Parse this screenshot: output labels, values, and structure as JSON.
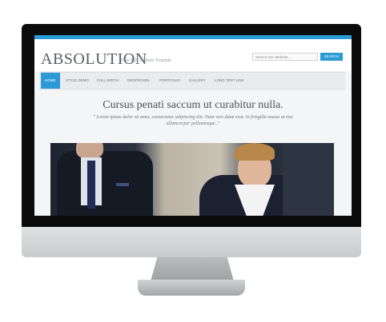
{
  "site": {
    "logo": "ABSOLUTION",
    "tagline": "Free PSD Website Template",
    "search_placeholder": "Search Our Website...",
    "search_button": "SEARCH",
    "accent_color": "#2a9bd7"
  },
  "nav": {
    "items": [
      {
        "label": "HOME",
        "active": true
      },
      {
        "label": "STYLE DEMO",
        "active": false
      },
      {
        "label": "FULL WIDTH",
        "active": false
      },
      {
        "label": "DROPDOWN",
        "active": false
      },
      {
        "label": "PORTFOLIO",
        "active": false
      },
      {
        "label": "GALLERY",
        "active": false
      },
      {
        "label": "LONG TEXT LINK",
        "active": false
      }
    ]
  },
  "hero": {
    "title": "Cursus penati saccum ut curabitur nulla.",
    "subtitle": "\" Lorem ipsum dolor sit amet, consectetur adipiscing elit. Nunc non diam erat. In fringilla massa ut nisi ullamcorper pellentesque .\""
  }
}
